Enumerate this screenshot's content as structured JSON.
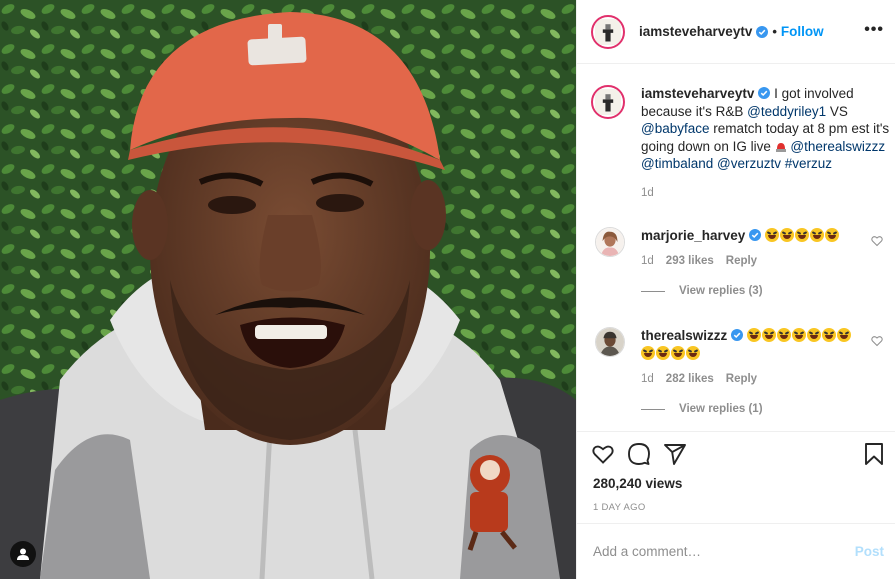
{
  "media": {
    "type": "video",
    "icons": {
      "user_tag": "user-icon"
    }
  },
  "header": {
    "username": "iamsteveharveytv",
    "separator": "•",
    "follow_label": "Follow",
    "more_label": "•••"
  },
  "caption": {
    "username": "iamsteveharveytv",
    "text_1": " I got involved because it's R&B ",
    "mention_1": "@teddyriley1",
    "text_2": " VS ",
    "mention_2": "@babyface",
    "text_3": " rematch today at 8 pm est it's going down on IG live ",
    "mention_3": "@therealswizzz",
    "mention_4": "@timbaland",
    "mention_5": "@verzuztv",
    "hashtag_1": "#verzuz",
    "time": "1d"
  },
  "comments": [
    {
      "username": "marjorie_harvey",
      "emoji_count": 5,
      "time": "1d",
      "likes": "293 likes",
      "reply_label": "Reply",
      "view_replies": "View replies (3)"
    },
    {
      "username": "therealswizzz",
      "emoji_count": 11,
      "time": "1d",
      "likes": "282 likes",
      "reply_label": "Reply",
      "view_replies": "View replies (1)"
    }
  ],
  "actions": {
    "views": "280,240 views",
    "posted_ago": "1 DAY AGO",
    "icons": [
      "heart-icon",
      "comment-icon",
      "share-icon",
      "bookmark-icon"
    ]
  },
  "add_comment": {
    "placeholder": "Add a comment…",
    "post_label": "Post"
  },
  "colors": {
    "accent": "#0095f6",
    "post_disabled": "#b2dffc",
    "muted": "#8e8e8e",
    "link": "#00376b",
    "cap": "#e2674a",
    "foliage": "#2f5a2a"
  }
}
